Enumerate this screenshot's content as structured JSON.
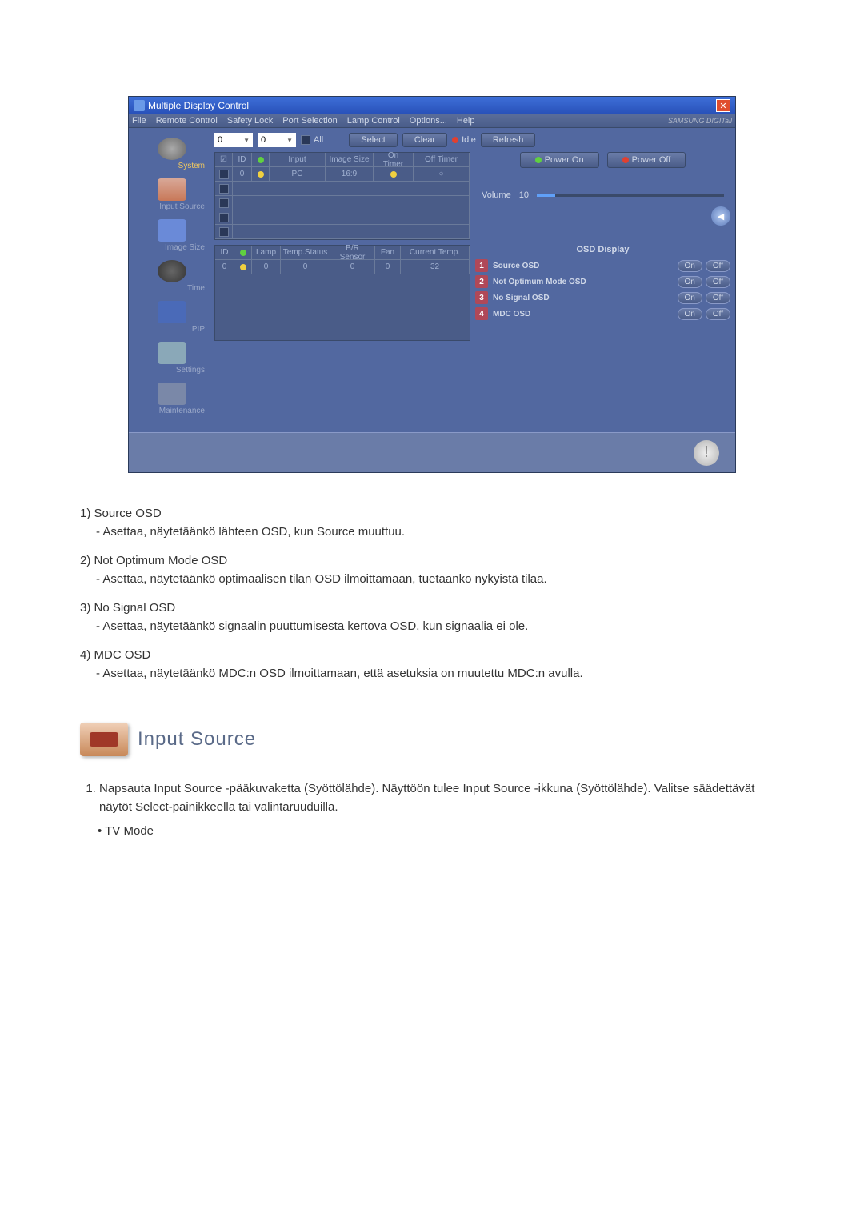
{
  "window": {
    "title": "Multiple Display Control",
    "brand": "SAMSUNG DIGITall"
  },
  "menu": {
    "file": "File",
    "remote": "Remote Control",
    "safety": "Safety Lock",
    "port": "Port Selection",
    "lamp": "Lamp Control",
    "options": "Options...",
    "help": "Help"
  },
  "sidebar": {
    "system": "System",
    "input_source": "Input Source",
    "image_size": "Image Size",
    "time": "Time",
    "pip": "PIP",
    "settings": "Settings",
    "maintenance": "Maintenance"
  },
  "controls": {
    "dd1": "0",
    "dd2": "0",
    "all": "All",
    "select": "Select",
    "clear": "Clear",
    "idle": "Idle",
    "refresh": "Refresh",
    "power_on": "Power On",
    "power_off": "Power Off",
    "volume_label": "Volume",
    "volume_value": "10"
  },
  "table1": {
    "headers": [
      "",
      "ID",
      "",
      "Input",
      "Image Size",
      "On Timer",
      "Off Timer"
    ],
    "row": [
      "",
      "0",
      "",
      "PC",
      "16:9",
      "",
      ""
    ]
  },
  "table2": {
    "headers": [
      "ID",
      "",
      "Lamp",
      "Temp.Status",
      "B/R Sensor",
      "Fan",
      "Current Temp."
    ],
    "row": [
      "0",
      "",
      "0",
      "0",
      "0",
      "0",
      "32"
    ]
  },
  "osd": {
    "title": "OSD Display",
    "on": "On",
    "off": "Off",
    "items": [
      {
        "num": "1",
        "label": "Source OSD"
      },
      {
        "num": "2",
        "label": "Not Optimum Mode OSD"
      },
      {
        "num": "3",
        "label": "No Signal OSD"
      },
      {
        "num": "4",
        "label": "MDC OSD"
      }
    ]
  },
  "doc": {
    "items": [
      {
        "title": "1)  Source OSD",
        "desc": "- Asettaa, näytetäänkö lähteen OSD, kun Source muuttuu."
      },
      {
        "title": "2)  Not Optimum Mode OSD",
        "desc": "- Asettaa, näytetäänkö optimaalisen tilan OSD ilmoittamaan, tuetaanko nykyistä tilaa."
      },
      {
        "title": "3)  No Signal OSD",
        "desc": "- Asettaa, näytetäänkö signaalin puuttumisesta kertova OSD, kun signaalia ei ole."
      },
      {
        "title": "4)  MDC OSD",
        "desc": "- Asettaa, näytetäänkö MDC:n OSD ilmoittamaan, että asetuksia on muutettu MDC:n avulla."
      }
    ],
    "section_title": "Input Source",
    "ol1": "Napsauta Input Source -pääkuvaketta (Syöttölähde). Näyttöön tulee Input Source -ikkuna (Syöttölähde). Valitse säädettävät näytöt Select-painikkeella tai valintaruuduilla.",
    "bullet1": "• TV Mode"
  }
}
